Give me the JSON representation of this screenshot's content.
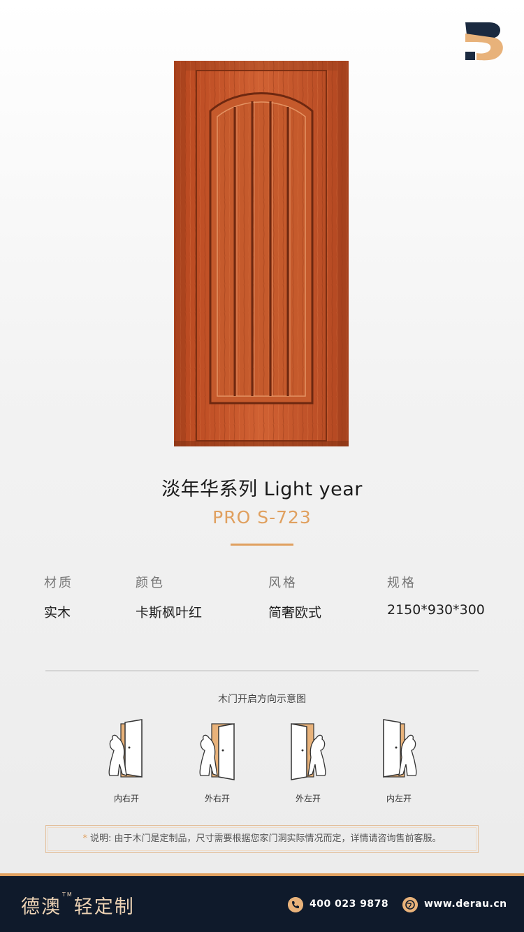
{
  "product": {
    "title": "淡年华系列  Light year",
    "model": "PRO S-723"
  },
  "specs": [
    {
      "label": "材质",
      "value": "实木"
    },
    {
      "label": "颜色",
      "value": "卡斯枫叶红"
    },
    {
      "label": "风格",
      "value": "简奢欧式"
    },
    {
      "label": "规格",
      "value": "2150*930*300"
    }
  ],
  "diagram": {
    "title": "木门开启方向示意图",
    "openings": [
      {
        "label": "内右开",
        "icon": "door-open-inward-right-icon"
      },
      {
        "label": "外右开",
        "icon": "door-open-outward-right-icon"
      },
      {
        "label": "外左开",
        "icon": "door-open-outward-left-icon"
      },
      {
        "label": "内左开",
        "icon": "door-open-inward-left-icon"
      }
    ]
  },
  "note": {
    "star": "*",
    "text": "说明: 由于木门是定制品，尺寸需要根据您家门洞实际情况而定，详情请咨询售前客服。"
  },
  "footer": {
    "brand": "德澳",
    "tm": "TM",
    "brand_suffix": "轻定制",
    "phone": "400 023 9878",
    "website": "www.derau.cn"
  },
  "colors": {
    "accent": "#e0a05f",
    "footer_bg": "#0f1a2b",
    "door_wood": "#c8542a"
  }
}
